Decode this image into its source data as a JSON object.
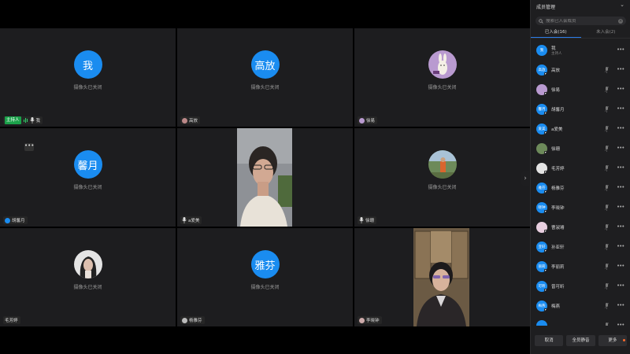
{
  "grid": {
    "cam_off_text": "摄像头已关闭",
    "host_badge": "主持人",
    "tiles": [
      {
        "avatar_text": "我",
        "name": "我"
      },
      {
        "avatar_text": "高放",
        "name": "高放"
      },
      {
        "avatar_text": "",
        "name": "徐易"
      },
      {
        "avatar_text": "馨月",
        "name": "胡馨月"
      },
      {
        "avatar_text": "",
        "name": "a爱美"
      },
      {
        "avatar_text": "",
        "name": "徐珊"
      },
      {
        "avatar_text": "",
        "name": "毛芳婷"
      },
      {
        "avatar_text": "雅芬",
        "name": "杨雅芬"
      },
      {
        "avatar_text": "",
        "name": "李晓钟"
      }
    ],
    "more_label": "•••"
  },
  "panel": {
    "title": "成员管理",
    "search_placeholder": "搜索已入会成员",
    "tabs": [
      {
        "label": "已入会(16)",
        "active": true
      },
      {
        "label": "未入会(2)",
        "active": false
      }
    ],
    "participants": [
      {
        "avatar": "我",
        "name": "我",
        "role": "主持人"
      },
      {
        "avatar": "高放",
        "name": "高放"
      },
      {
        "avatar": "",
        "name": "徐易"
      },
      {
        "avatar": "馨月",
        "name": "胡馨月"
      },
      {
        "avatar": "爱美",
        "name": "a爱美"
      },
      {
        "avatar": "",
        "name": "徐珊"
      },
      {
        "avatar": "",
        "name": "毛芳婷"
      },
      {
        "avatar": "雅芬",
        "name": "杨雅芬"
      },
      {
        "avatar": "晓钟",
        "name": "李晓钟"
      },
      {
        "avatar": "",
        "name": "曹淑璿"
      },
      {
        "avatar": "亚轩",
        "name": "孙亚轩"
      },
      {
        "avatar": "丽莉",
        "name": "李丽莉"
      },
      {
        "avatar": "可昕",
        "name": "曾可昕"
      },
      {
        "avatar": "梅燕",
        "name": "梅燕"
      },
      {
        "avatar": "",
        "name": ""
      }
    ],
    "more_label": "•••",
    "footer": {
      "cancel": "取消",
      "mute_all": "全员静音",
      "more": "更多"
    }
  }
}
